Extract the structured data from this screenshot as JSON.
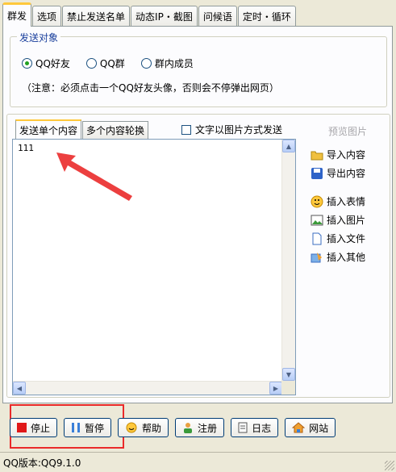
{
  "tabs": [
    "群发",
    "选项",
    "禁止发送名单",
    "动态IP・截图",
    "问候语",
    "定时・循环"
  ],
  "target_group": {
    "legend": "发送对象",
    "options": [
      {
        "label": "QQ好友",
        "selected": true
      },
      {
        "label": "QQ群",
        "selected": false
      },
      {
        "label": "群内成员",
        "selected": false
      }
    ],
    "note": "（注意：必须点击一个QQ好友头像，否则会不停弹出网页）"
  },
  "content": {
    "subtabs": [
      "发送单个内容",
      "多个内容轮换"
    ],
    "checkbox_label": "文字以图片方式发送",
    "preview_label": "预览图片",
    "editor_text": "111"
  },
  "side_actions": [
    {
      "label": "导入内容",
      "icon": "folder-icon"
    },
    {
      "label": "导出内容",
      "icon": "save-icon"
    },
    {
      "label": "插入表情",
      "icon": "smiley-icon"
    },
    {
      "label": "插入图片",
      "icon": "image-icon"
    },
    {
      "label": "插入文件",
      "icon": "file-icon"
    },
    {
      "label": "插入其他",
      "icon": "other-icon"
    }
  ],
  "buttons": [
    {
      "label": "停止",
      "icon": "stop-icon"
    },
    {
      "label": "暂停",
      "icon": "pause-icon"
    },
    {
      "label": "帮助",
      "icon": "help-icon"
    },
    {
      "label": "注册",
      "icon": "register-icon"
    },
    {
      "label": "日志",
      "icon": "log-icon"
    },
    {
      "label": "网站",
      "icon": "home-icon"
    }
  ],
  "status": {
    "version": "QQ版本:QQ9.1.0"
  },
  "colors": {
    "tab_highlight": "#ffc83c",
    "annotation_red": "#ea2a2a",
    "legend_blue": "#1a3f9c"
  }
}
